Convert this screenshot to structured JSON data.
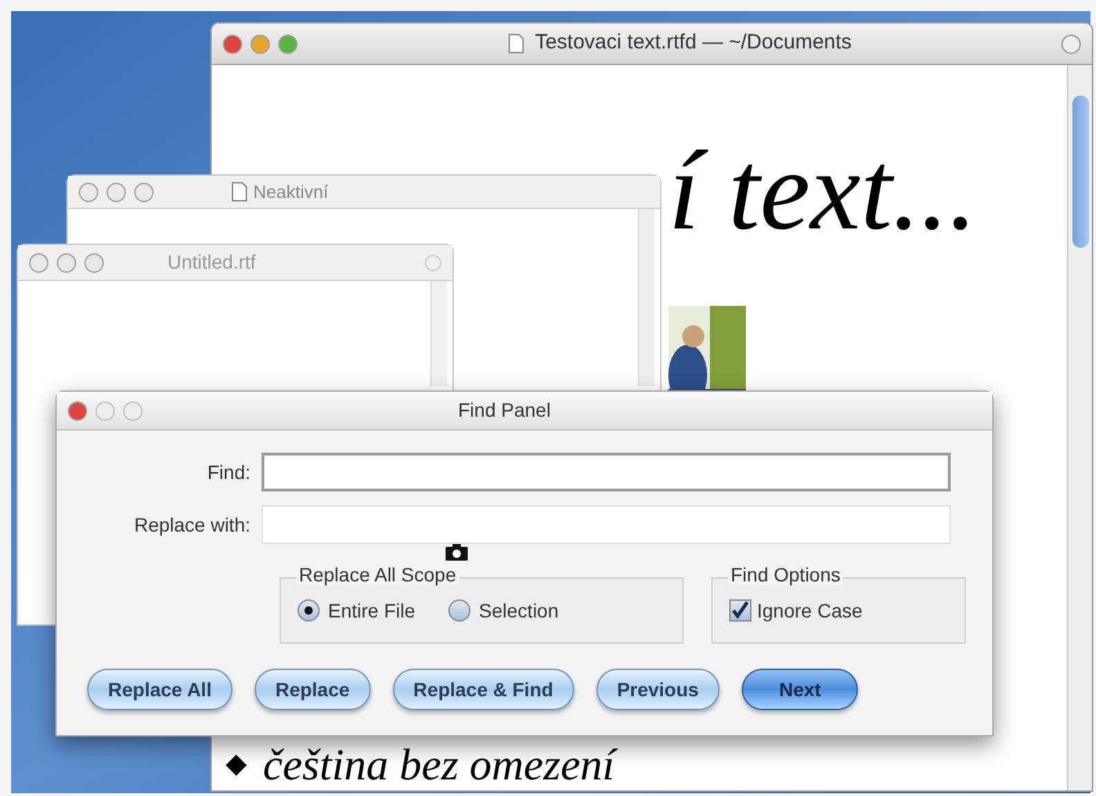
{
  "document_window": {
    "title": "Testovaci text.rtfd — ~/Documents",
    "heading": "í text...",
    "bullet": "◆",
    "bullet_text": "čeština bez omezení"
  },
  "inactive_window": {
    "title": "Neaktivní"
  },
  "untitled_window": {
    "title": "Untitled.rtf"
  },
  "find_panel": {
    "title": "Find Panel",
    "fields": [
      {
        "label": "Find:",
        "focused": true
      },
      {
        "label": "Replace with:",
        "focused": false
      }
    ],
    "scope": {
      "title": "Replace All Scope",
      "options": [
        {
          "label": "Entire File",
          "selected": true
        },
        {
          "label": "Selection",
          "selected": false
        }
      ]
    },
    "find_options": {
      "title": "Find Options",
      "options": [
        {
          "label": "Ignore Case",
          "checked": true
        }
      ]
    },
    "buttons": [
      {
        "label": "Replace All",
        "default": false
      },
      {
        "label": "Replace",
        "default": false
      },
      {
        "label": "Replace & Find",
        "default": false
      },
      {
        "label": "Previous",
        "default": false
      },
      {
        "label": "Next",
        "default": true
      }
    ]
  }
}
